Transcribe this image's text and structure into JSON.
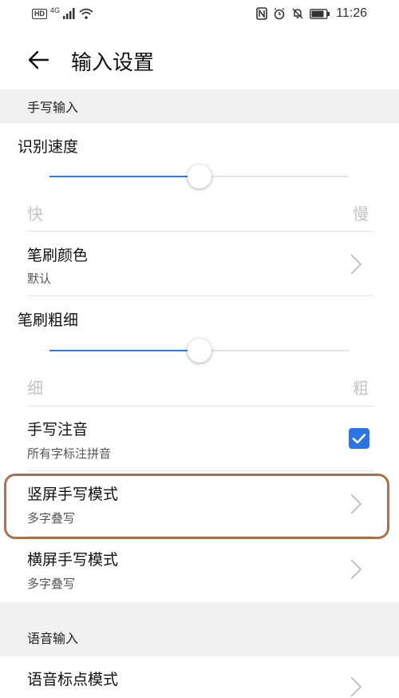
{
  "status_bar": {
    "time": "11:26",
    "hd": "HD",
    "network": "4G"
  },
  "header": {
    "title": "输入设置"
  },
  "handwriting": {
    "section_title": "手写输入",
    "speed": {
      "label": "识别速度",
      "min_label": "快",
      "max_label": "慢",
      "value": 0.5
    },
    "brush_color": {
      "title": "笔刷颜色",
      "value": "默认"
    },
    "thickness": {
      "label": "笔刷粗细",
      "min_label": "细",
      "max_label": "粗",
      "value": 0.5
    },
    "phonetic": {
      "title": "手写注音",
      "subtitle": "所有字标注拼音",
      "checked": true
    },
    "portrait_mode": {
      "title": "竖屏手写模式",
      "value": "多字叠写"
    },
    "landscape_mode": {
      "title": "横屏手写模式",
      "value": "多字叠写"
    }
  },
  "voice": {
    "section_title": "语音输入",
    "punctuation_mode": {
      "title": "语音标点模式"
    }
  },
  "colors": {
    "accent": "#2f7be6",
    "highlight": "#a9724d"
  }
}
